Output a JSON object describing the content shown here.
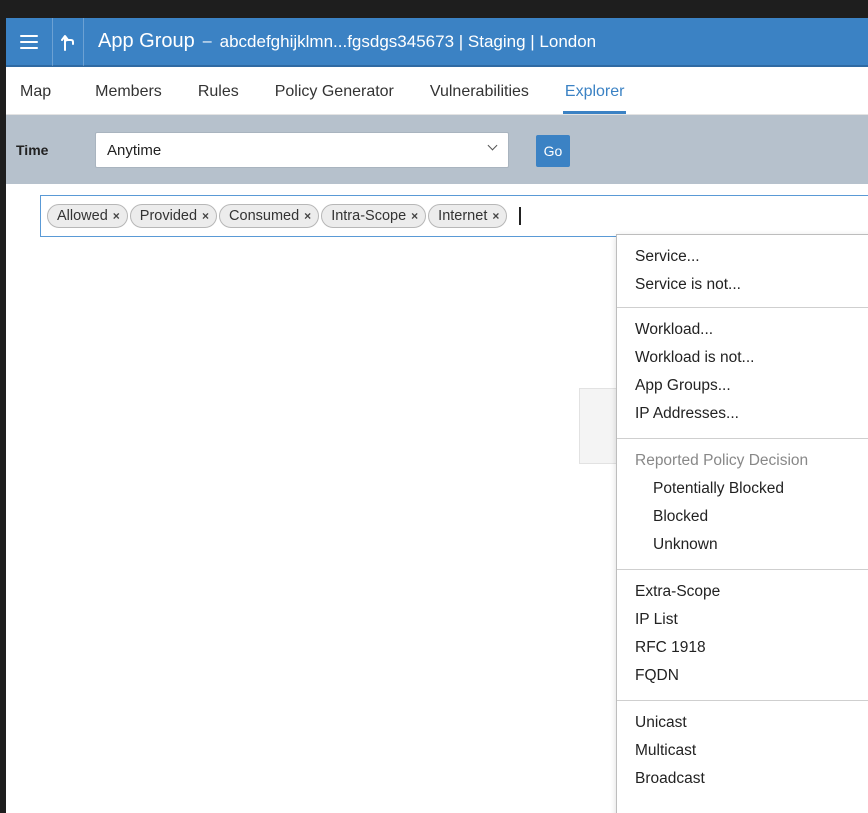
{
  "header": {
    "app_title": "App Group",
    "separator": "–",
    "subtitle": "abcdefghijklmn...fgsdgs345673 | Staging | London",
    "up_icon": "ꕯ"
  },
  "tabs": [
    {
      "label": "Map",
      "active": false
    },
    {
      "label": "Members",
      "active": false
    },
    {
      "label": "Rules",
      "active": false
    },
    {
      "label": "Policy Generator",
      "active": false
    },
    {
      "label": "Vulnerabilities",
      "active": false
    },
    {
      "label": "Explorer",
      "active": true
    }
  ],
  "filter": {
    "time_label": "Time",
    "time_value": "Anytime",
    "go_label": "Go"
  },
  "tokens": [
    {
      "label": "Allowed",
      "remove": "×"
    },
    {
      "label": "Provided",
      "remove": "×"
    },
    {
      "label": "Consumed",
      "remove": "×"
    },
    {
      "label": "Intra-Scope",
      "remove": "×"
    },
    {
      "label": "Internet",
      "remove": "×"
    }
  ],
  "dropdown": {
    "group1": [
      "Service...",
      "Service is not..."
    ],
    "group2": [
      "Workload...",
      "Workload is not...",
      "App Groups...",
      "IP Addresses..."
    ],
    "group3_heading": "Reported Policy Decision",
    "group3": [
      "Potentially Blocked",
      "Blocked",
      "Unknown"
    ],
    "group4": [
      "Extra-Scope",
      "IP List",
      "RFC 1918",
      "FQDN"
    ],
    "group5": [
      "Unicast",
      "Multicast",
      "Broadcast"
    ]
  },
  "colors": {
    "header_bg": "#3b82c4",
    "filterbar_bg": "#b6c1cc",
    "accent": "#3b82c4"
  }
}
